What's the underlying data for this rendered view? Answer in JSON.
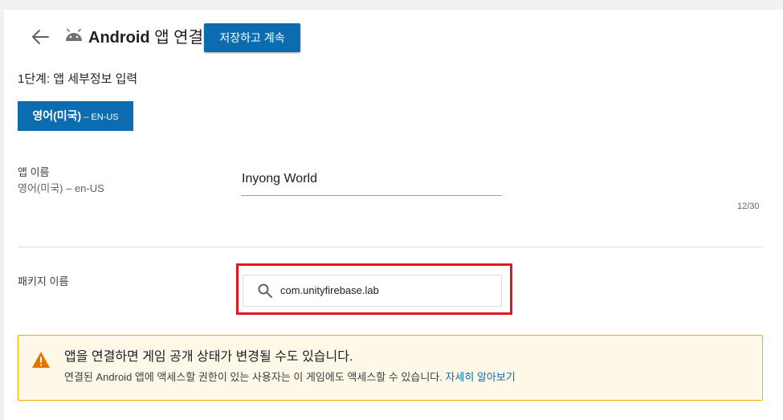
{
  "header": {
    "brand": "Android",
    "title_suffix": " 앱 연결",
    "save_button": "저장하고 계속"
  },
  "step_label": "1단계: 앱 세부정보 입력",
  "language_tab": {
    "name": "영어(미국)",
    "code": " – EN-US"
  },
  "app_name": {
    "label": "앱 이름",
    "sublabel": "영어(미국) – en-US",
    "value": "Inyong World",
    "counter": "12/30"
  },
  "package": {
    "label": "패키지 이름",
    "value": "com.unityfirebase.lab"
  },
  "warning": {
    "title": "앱을 연결하면 게임 공개 상태가 변경될 수도 있습니다.",
    "description": "연결된 Android 앱에 액세스할 권한이 있는 사용자는 이 게임에도 액세스할 수 있습니다. ",
    "link": "자세히 알아보기"
  },
  "colors": {
    "primary": "#0b6cb0",
    "highlight": "#e3161f",
    "warning_bg": "#fef8e8",
    "warning_border": "#f9ab00",
    "warning_icon": "#e37400"
  },
  "icons": [
    "back-arrow-icon",
    "android-icon",
    "search-icon",
    "warning-icon"
  ]
}
